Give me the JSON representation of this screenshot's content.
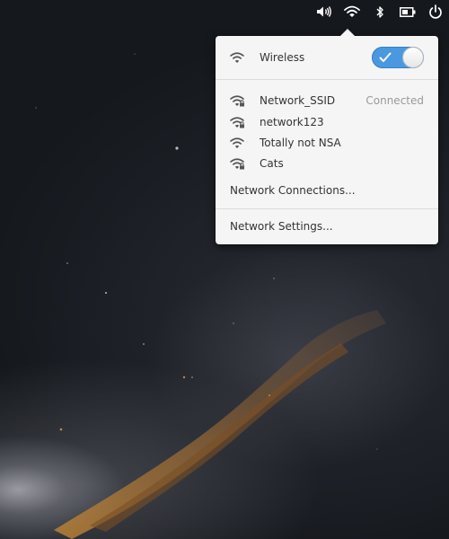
{
  "panel": {
    "indicators": [
      {
        "icon": "volume-icon"
      },
      {
        "icon": "wifi-icon"
      },
      {
        "icon": "bluetooth-icon"
      },
      {
        "icon": "battery-icon"
      },
      {
        "icon": "power-icon"
      }
    ]
  },
  "popover": {
    "wireless": {
      "label": "Wireless",
      "enabled": true
    },
    "networks": [
      {
        "ssid": "Network_SSID",
        "status": "Connected",
        "secured": true
      },
      {
        "ssid": "network123",
        "status": "",
        "secured": true
      },
      {
        "ssid": "Totally not NSA",
        "status": "",
        "secured": false
      },
      {
        "ssid": "Cats",
        "status": "",
        "secured": true
      }
    ],
    "connections_link": "Network Connections...",
    "settings_link": "Network Settings..."
  },
  "colors": {
    "accent": "#4a98e0",
    "popover_bg": "#f5f5f5",
    "text": "#333333",
    "status_text": "#9a9a9a"
  }
}
